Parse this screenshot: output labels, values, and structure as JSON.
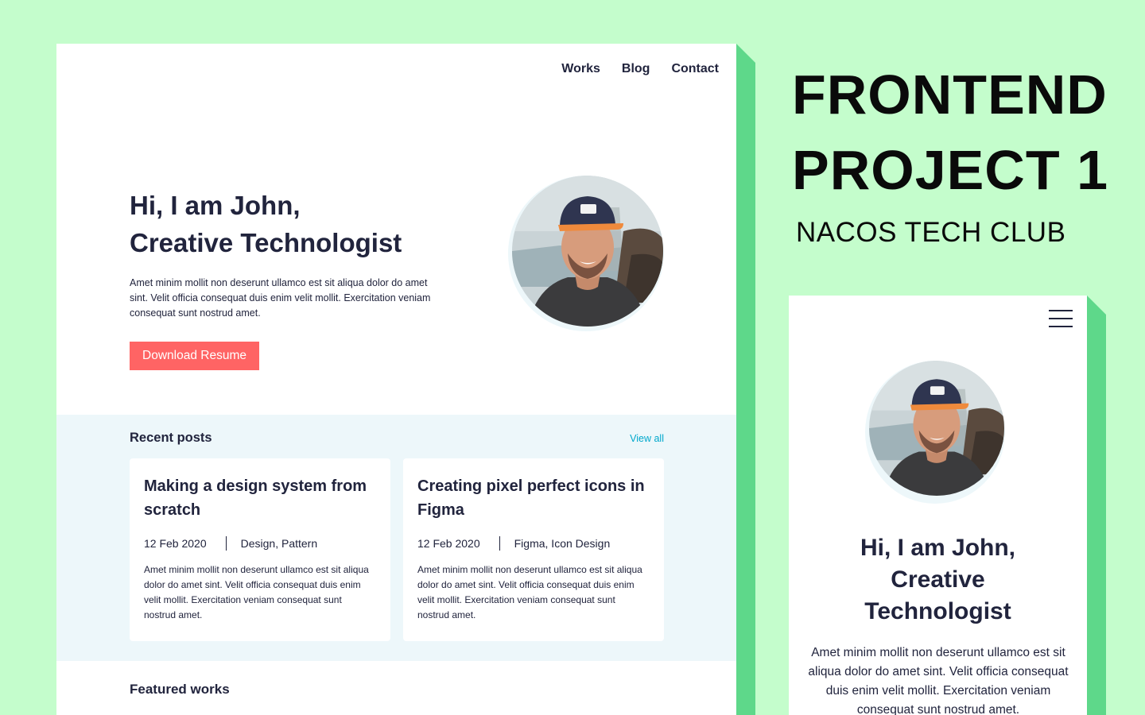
{
  "nav": {
    "items": [
      "Works",
      "Blog",
      "Contact"
    ]
  },
  "hero": {
    "line1": "Hi, I am John,",
    "line2": "Creative Technologist",
    "text": "Amet minim mollit non deserunt ullamco est sit aliqua dolor do amet sint. Velit officia consequat duis enim velit mollit. Exercitation veniam consequat sunt nostrud amet.",
    "button": "Download Resume"
  },
  "posts": {
    "title": "Recent posts",
    "view_all": "View all",
    "items": [
      {
        "title": "Making a design system from scratch",
        "date": "12 Feb 2020",
        "tags": "Design, Pattern",
        "text": "Amet minim mollit non deserunt ullamco est sit aliqua dolor do amet sint. Velit officia consequat duis enim velit mollit. Exercitation veniam consequat sunt nostrud amet."
      },
      {
        "title": "Creating pixel perfect icons in Figma",
        "date": "12 Feb 2020",
        "tags": "Figma, Icon Design",
        "text": "Amet minim mollit non deserunt ullamco est sit aliqua dolor do amet sint. Velit officia consequat duis enim velit mollit. Exercitation veniam consequat sunt nostrud amet."
      }
    ]
  },
  "featured": {
    "title": "Featured works"
  },
  "banner": {
    "line1": "FRONTEND",
    "line2": "PROJECT 1",
    "club": "NACOS TECH CLUB"
  },
  "mobile": {
    "line1": "Hi, I am John,",
    "line2": "Creative",
    "line3": "Technologist",
    "text": "Amet minim mollit non deserunt ullamco est sit aliqua dolor do amet sint. Velit officia consequat duis enim velit mollit. Exercitation veniam consequat sunt nostrud amet."
  },
  "colors": {
    "background": "#c4fdcc",
    "accent_shadow": "#5ed88a",
    "primary_button": "#ff6464",
    "link": "#00a8cc",
    "section_bg": "#edf7fa",
    "text": "#21243d"
  }
}
